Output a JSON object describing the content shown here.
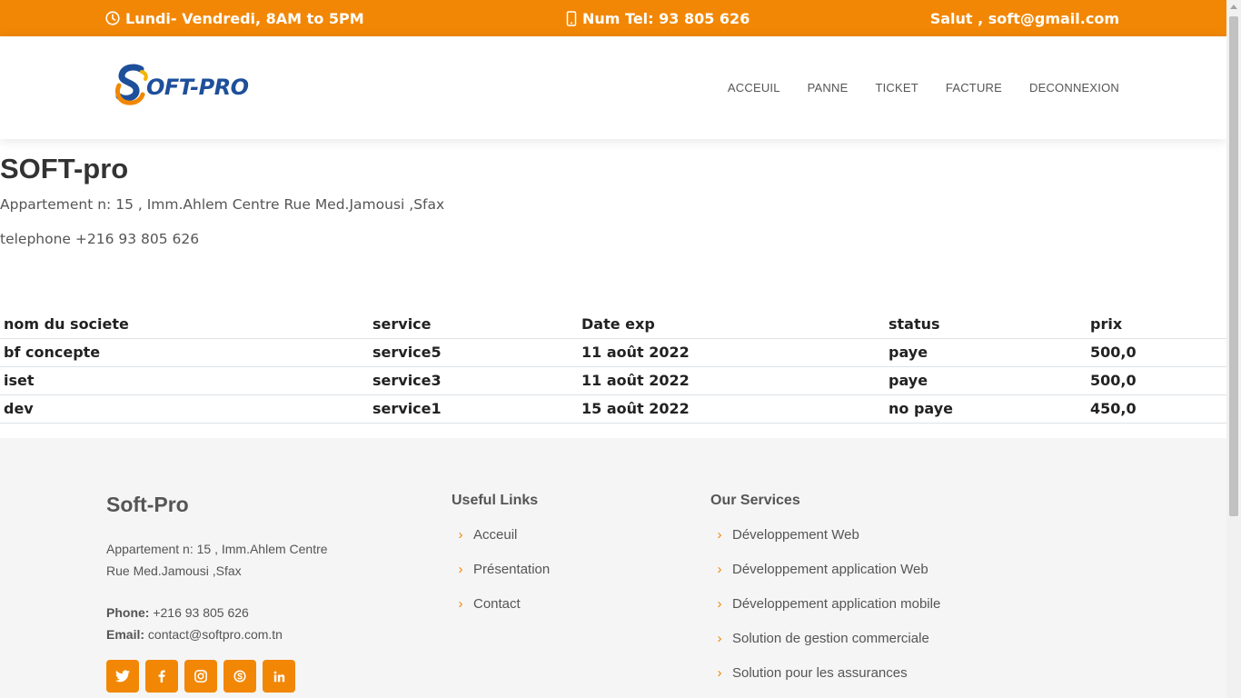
{
  "topbar": {
    "hours": "Lundi- Vendredi, 8AM to 5PM",
    "phone": "Num Tel: 93 805 626",
    "greeting": "Salut , soft@gmail.com",
    "color": "#f28705"
  },
  "header": {
    "logo_text": "OFT-PRO",
    "nav": [
      "ACCEUIL",
      "PANNE",
      "TICKET",
      "FACTURE",
      "DECONNEXION"
    ]
  },
  "company": {
    "name": "SOFT-pro",
    "address": "Appartement n: 15 , Imm.Ahlem Centre Rue Med.Jamousi ,Sfax",
    "telephone": "telephone +216 93 805 626"
  },
  "invoices": {
    "columns": [
      "nom du societe",
      "service",
      "Date exp",
      "status",
      "prix"
    ],
    "rows": [
      [
        "bf concepte",
        "service5",
        "11 août 2022",
        "paye",
        "500,0"
      ],
      [
        "iset",
        "service3",
        "11 août 2022",
        "paye",
        "500,0"
      ],
      [
        "dev",
        "service1",
        "15 août 2022",
        "no paye",
        "450,0"
      ]
    ]
  },
  "footer": {
    "brand": "Soft-Pro",
    "address": "Appartement n: 15 , Imm.Ahlem Centre Rue Med.Jamousi ,Sfax",
    "phone_label": "Phone:",
    "phone": "+216 93 805 626",
    "email_label": "Email:",
    "email": "contact@softpro.com.tn",
    "useful_title": "Useful Links",
    "useful_links": [
      "Acceuil",
      "Présentation",
      "Contact"
    ],
    "services_title": "Our Services",
    "services": [
      "Développement Web",
      "Développement application Web",
      "Développement application mobile",
      "Solution de gestion commerciale",
      "Solution pour les assurances"
    ],
    "socials": [
      "twitter-icon",
      "facebook-icon",
      "instagram-icon",
      "skype-icon",
      "linkedin-icon"
    ]
  }
}
